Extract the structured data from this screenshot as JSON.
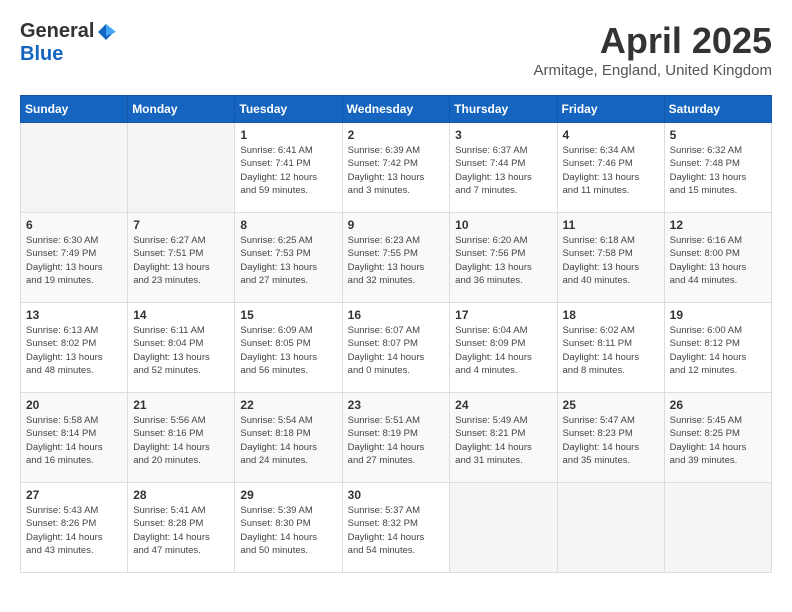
{
  "header": {
    "logo_general": "General",
    "logo_blue": "Blue",
    "month": "April 2025",
    "location": "Armitage, England, United Kingdom"
  },
  "weekdays": [
    "Sunday",
    "Monday",
    "Tuesday",
    "Wednesday",
    "Thursday",
    "Friday",
    "Saturday"
  ],
  "weeks": [
    [
      {
        "day": "",
        "info": ""
      },
      {
        "day": "",
        "info": ""
      },
      {
        "day": "1",
        "info": "Sunrise: 6:41 AM\nSunset: 7:41 PM\nDaylight: 12 hours\nand 59 minutes."
      },
      {
        "day": "2",
        "info": "Sunrise: 6:39 AM\nSunset: 7:42 PM\nDaylight: 13 hours\nand 3 minutes."
      },
      {
        "day": "3",
        "info": "Sunrise: 6:37 AM\nSunset: 7:44 PM\nDaylight: 13 hours\nand 7 minutes."
      },
      {
        "day": "4",
        "info": "Sunrise: 6:34 AM\nSunset: 7:46 PM\nDaylight: 13 hours\nand 11 minutes."
      },
      {
        "day": "5",
        "info": "Sunrise: 6:32 AM\nSunset: 7:48 PM\nDaylight: 13 hours\nand 15 minutes."
      }
    ],
    [
      {
        "day": "6",
        "info": "Sunrise: 6:30 AM\nSunset: 7:49 PM\nDaylight: 13 hours\nand 19 minutes."
      },
      {
        "day": "7",
        "info": "Sunrise: 6:27 AM\nSunset: 7:51 PM\nDaylight: 13 hours\nand 23 minutes."
      },
      {
        "day": "8",
        "info": "Sunrise: 6:25 AM\nSunset: 7:53 PM\nDaylight: 13 hours\nand 27 minutes."
      },
      {
        "day": "9",
        "info": "Sunrise: 6:23 AM\nSunset: 7:55 PM\nDaylight: 13 hours\nand 32 minutes."
      },
      {
        "day": "10",
        "info": "Sunrise: 6:20 AM\nSunset: 7:56 PM\nDaylight: 13 hours\nand 36 minutes."
      },
      {
        "day": "11",
        "info": "Sunrise: 6:18 AM\nSunset: 7:58 PM\nDaylight: 13 hours\nand 40 minutes."
      },
      {
        "day": "12",
        "info": "Sunrise: 6:16 AM\nSunset: 8:00 PM\nDaylight: 13 hours\nand 44 minutes."
      }
    ],
    [
      {
        "day": "13",
        "info": "Sunrise: 6:13 AM\nSunset: 8:02 PM\nDaylight: 13 hours\nand 48 minutes."
      },
      {
        "day": "14",
        "info": "Sunrise: 6:11 AM\nSunset: 8:04 PM\nDaylight: 13 hours\nand 52 minutes."
      },
      {
        "day": "15",
        "info": "Sunrise: 6:09 AM\nSunset: 8:05 PM\nDaylight: 13 hours\nand 56 minutes."
      },
      {
        "day": "16",
        "info": "Sunrise: 6:07 AM\nSunset: 8:07 PM\nDaylight: 14 hours\nand 0 minutes."
      },
      {
        "day": "17",
        "info": "Sunrise: 6:04 AM\nSunset: 8:09 PM\nDaylight: 14 hours\nand 4 minutes."
      },
      {
        "day": "18",
        "info": "Sunrise: 6:02 AM\nSunset: 8:11 PM\nDaylight: 14 hours\nand 8 minutes."
      },
      {
        "day": "19",
        "info": "Sunrise: 6:00 AM\nSunset: 8:12 PM\nDaylight: 14 hours\nand 12 minutes."
      }
    ],
    [
      {
        "day": "20",
        "info": "Sunrise: 5:58 AM\nSunset: 8:14 PM\nDaylight: 14 hours\nand 16 minutes."
      },
      {
        "day": "21",
        "info": "Sunrise: 5:56 AM\nSunset: 8:16 PM\nDaylight: 14 hours\nand 20 minutes."
      },
      {
        "day": "22",
        "info": "Sunrise: 5:54 AM\nSunset: 8:18 PM\nDaylight: 14 hours\nand 24 minutes."
      },
      {
        "day": "23",
        "info": "Sunrise: 5:51 AM\nSunset: 8:19 PM\nDaylight: 14 hours\nand 27 minutes."
      },
      {
        "day": "24",
        "info": "Sunrise: 5:49 AM\nSunset: 8:21 PM\nDaylight: 14 hours\nand 31 minutes."
      },
      {
        "day": "25",
        "info": "Sunrise: 5:47 AM\nSunset: 8:23 PM\nDaylight: 14 hours\nand 35 minutes."
      },
      {
        "day": "26",
        "info": "Sunrise: 5:45 AM\nSunset: 8:25 PM\nDaylight: 14 hours\nand 39 minutes."
      }
    ],
    [
      {
        "day": "27",
        "info": "Sunrise: 5:43 AM\nSunset: 8:26 PM\nDaylight: 14 hours\nand 43 minutes."
      },
      {
        "day": "28",
        "info": "Sunrise: 5:41 AM\nSunset: 8:28 PM\nDaylight: 14 hours\nand 47 minutes."
      },
      {
        "day": "29",
        "info": "Sunrise: 5:39 AM\nSunset: 8:30 PM\nDaylight: 14 hours\nand 50 minutes."
      },
      {
        "day": "30",
        "info": "Sunrise: 5:37 AM\nSunset: 8:32 PM\nDaylight: 14 hours\nand 54 minutes."
      },
      {
        "day": "",
        "info": ""
      },
      {
        "day": "",
        "info": ""
      },
      {
        "day": "",
        "info": ""
      }
    ]
  ]
}
